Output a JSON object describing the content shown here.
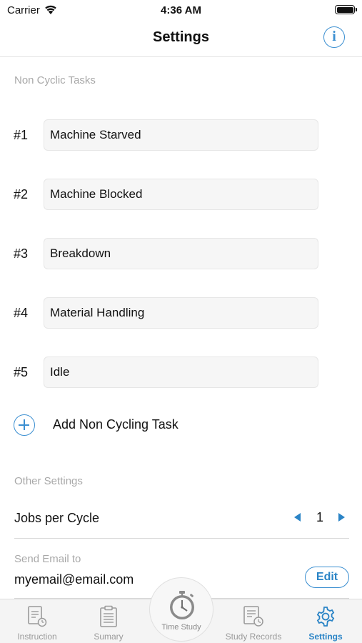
{
  "status_bar": {
    "carrier": "Carrier",
    "time": "4:36 AM"
  },
  "nav": {
    "title": "Settings",
    "info_symbol": "i"
  },
  "non_cyclic": {
    "header": "Non Cyclic Tasks",
    "tasks": [
      {
        "number": "#1",
        "name": "Machine Starved"
      },
      {
        "number": "#2",
        "name": "Machine Blocked"
      },
      {
        "number": "#3",
        "name": "Breakdown"
      },
      {
        "number": "#4",
        "name": "Material Handling"
      },
      {
        "number": "#5",
        "name": "Idle"
      }
    ],
    "add_label": "Add Non Cycling Task"
  },
  "other_settings": {
    "header": "Other Settings",
    "jobs_label": "Jobs per Cycle",
    "jobs_value": "1",
    "email_caption": "Send Email to",
    "email_value": "myemail@email.com",
    "edit_label": "Edit"
  },
  "tab_bar": {
    "tabs": [
      {
        "label": "Instruction",
        "icon": "instruction-icon"
      },
      {
        "label": "Sumary",
        "icon": "clipboard-icon"
      },
      {
        "label": "Time Study",
        "icon": "stopwatch-icon"
      },
      {
        "label": "Study Records",
        "icon": "records-icon"
      },
      {
        "label": "Settings",
        "icon": "gear-icon",
        "active": true
      }
    ]
  },
  "colors": {
    "accent": "#2a84c6",
    "muted": "#a8a8a8",
    "tab_inactive": "#9a9a9a"
  }
}
